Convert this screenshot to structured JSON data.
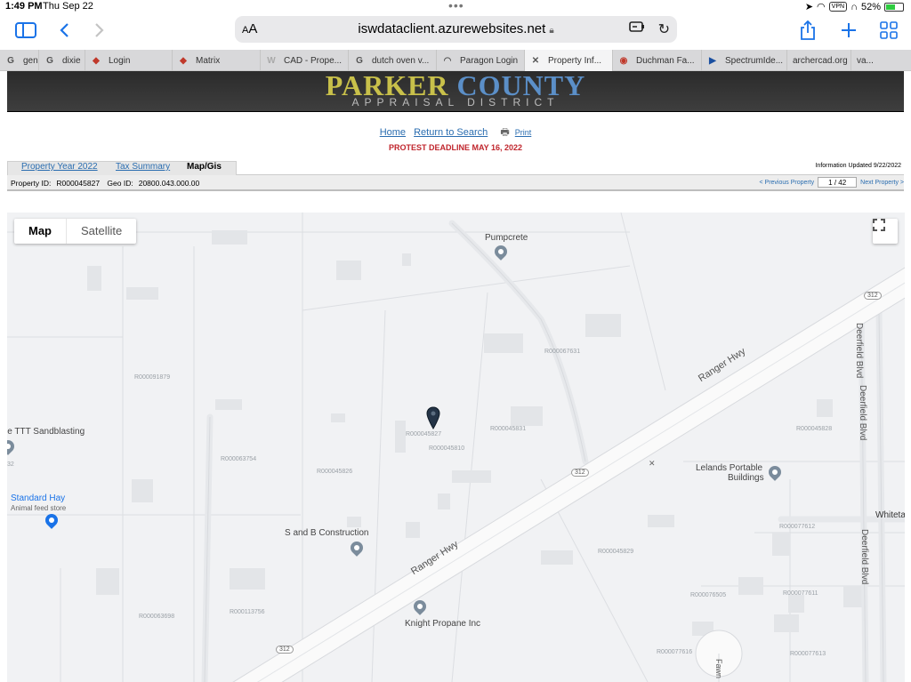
{
  "status": {
    "time": "1:49 PM",
    "date": "Thu Sep 22",
    "battery": "52%",
    "vpn": "VPN"
  },
  "toolbar": {
    "aa_big": "A",
    "aa_small": "A",
    "url": "iswdataclient.azurewebsites.net"
  },
  "tabs": [
    {
      "icon": "G",
      "label": "gen",
      "active": false
    },
    {
      "icon": "G",
      "label": "dixie",
      "active": false
    },
    {
      "icon": "◆",
      "label": "Login",
      "active": false
    },
    {
      "icon": "◆",
      "label": "Matrix",
      "active": false
    },
    {
      "icon": "W",
      "label": "CAD - Prope...",
      "active": false
    },
    {
      "icon": "G",
      "label": "dutch oven v...",
      "active": false
    },
    {
      "icon": "◠",
      "label": "Paragon Login",
      "active": false
    },
    {
      "icon": "✕",
      "label": "Property Inf...",
      "active": true
    },
    {
      "icon": "◉",
      "label": "Duchman Fa...",
      "active": false
    },
    {
      "icon": "▶",
      "label": "SpectrumIde...",
      "active": false
    },
    {
      "icon": "",
      "label": "archercad.org",
      "active": false
    },
    {
      "icon": "",
      "label": "va...",
      "active": false
    }
  ],
  "header": {
    "title_part1": "PARKER ",
    "title_part2": "COUNTY",
    "subtitle": "APPRAISAL DISTRICT"
  },
  "nav": {
    "home": "Home",
    "return": "Return to Search",
    "print": "Print"
  },
  "deadline": "PROTEST DEADLINE MAY 16, 2022",
  "property_tabs": {
    "year": "Property Year 2022",
    "tax": "Tax Summary",
    "map": "Map/Gis"
  },
  "info_updated": "Information Updated 9/22/2022",
  "ids": {
    "property_label": "Property ID:",
    "property_id": "R000045827",
    "geo_label": "Geo ID:",
    "geo_id": "20800.043.000.00"
  },
  "pager": {
    "prev": "< Previous Property",
    "current": "1 / 42",
    "next": "Next Property >"
  },
  "map": {
    "type_map": "Map",
    "type_satellite": "Satellite",
    "pois": [
      "Pumpcrete",
      "le TTT Sandblasting",
      "Standard Hay",
      "Animal feed store",
      "S and B Construction",
      "Lelands Portable",
      "Buildings",
      "Knight Propane Inc"
    ],
    "roads": [
      "Ranger Hwy",
      "Ranger Hwy",
      "Deerfield Blvd",
      "Deerfield Blvd",
      "Deerfield Blvd",
      "Whiteta",
      "Fawn"
    ],
    "shields": [
      "312",
      "312",
      "312"
    ],
    "parcels": [
      "R000091879",
      "R000067631",
      "R000045827",
      "R000045810",
      "R000045831",
      "R000045828",
      "R000063754",
      "R000045826",
      "R000077612",
      "R000045829",
      "R000076505",
      "R000077611",
      "R000063698",
      "R000113756",
      "R000077616",
      "R000077613",
      "32"
    ]
  }
}
